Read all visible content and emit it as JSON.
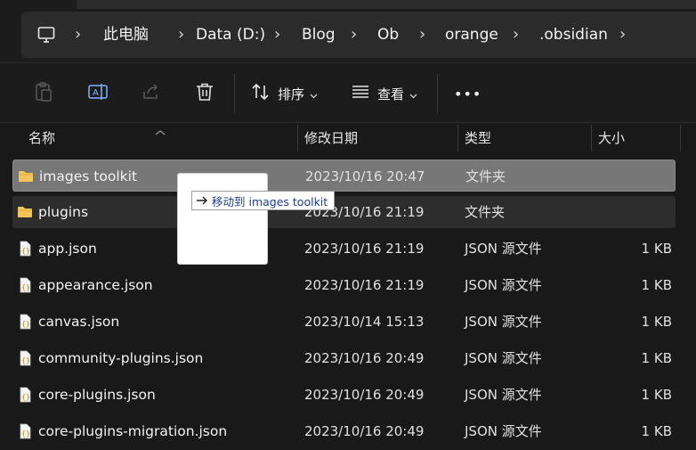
{
  "address": {
    "computer_icon": "computer-icon",
    "crumbs": [
      "此电脑",
      "Data (D:)",
      "Blog",
      "Ob",
      "orange",
      ".obsidian"
    ]
  },
  "toolbar": {
    "sort_label": "排序",
    "view_label": "查看",
    "more_label": "•••",
    "icons": [
      "clipboard-paste-icon",
      "rename-icon",
      "share-icon",
      "delete-icon",
      "sort-icon",
      "view-icon",
      "more-icon"
    ]
  },
  "columns": {
    "name": "名称",
    "modified": "修改日期",
    "type": "类型",
    "size": "大小"
  },
  "files": [
    {
      "name": "images toolkit",
      "modified": "2023/10/16 20:47",
      "type": "文件夹",
      "size": "",
      "icon": "folder-icon",
      "state": "selected"
    },
    {
      "name": "plugins",
      "modified": "2023/10/16 21:19",
      "type": "文件夹",
      "size": "",
      "icon": "folder-icon",
      "state": "highlight"
    },
    {
      "name": "app.json",
      "modified": "2023/10/16 21:19",
      "type": "JSON 源文件",
      "size": "1 KB",
      "icon": "json-file-icon",
      "state": ""
    },
    {
      "name": "appearance.json",
      "modified": "2023/10/16 21:19",
      "type": "JSON 源文件",
      "size": "1 KB",
      "icon": "json-file-icon",
      "state": ""
    },
    {
      "name": "canvas.json",
      "modified": "2023/10/14 15:13",
      "type": "JSON 源文件",
      "size": "1 KB",
      "icon": "json-file-icon",
      "state": ""
    },
    {
      "name": "community-plugins.json",
      "modified": "2023/10/16 20:49",
      "type": "JSON 源文件",
      "size": "1 KB",
      "icon": "json-file-icon",
      "state": ""
    },
    {
      "name": "core-plugins.json",
      "modified": "2023/10/16 20:49",
      "type": "JSON 源文件",
      "size": "1 KB",
      "icon": "json-file-icon",
      "state": ""
    },
    {
      "name": "core-plugins-migration.json",
      "modified": "2023/10/16 20:49",
      "type": "JSON 源文件",
      "size": "1 KB",
      "icon": "json-file-icon",
      "state": ""
    }
  ],
  "drag": {
    "tooltip": "移动到 images toolkit",
    "icon": "arrow-right-icon"
  },
  "colors": {
    "background": "#191919",
    "selected_row": "#777777",
    "folder": "#f2c55c",
    "tooltip_text": "#1a3e8c"
  }
}
